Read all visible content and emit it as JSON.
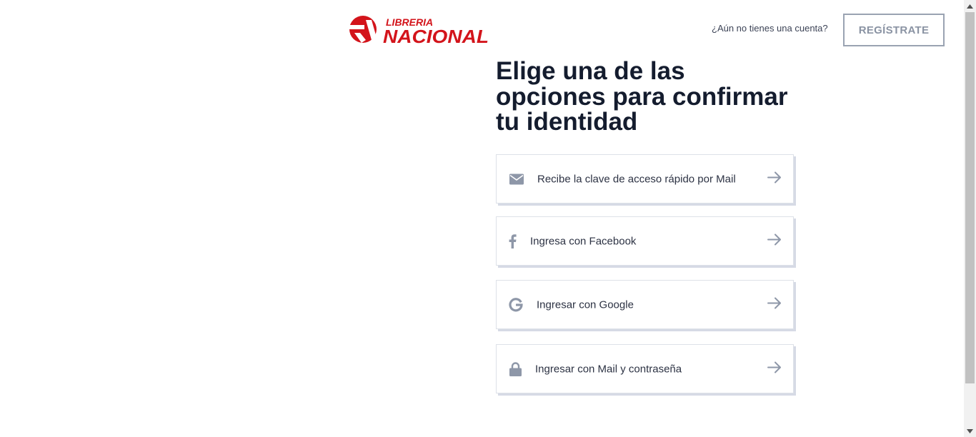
{
  "header": {
    "logo": {
      "top_text": "LIBRERIA",
      "main_text": "NACIONAL"
    },
    "account_question": "¿Aún no tienes una cuenta?",
    "register_label": "REGÍSTRATE"
  },
  "main": {
    "title": "Elige una de las opciones para confirmar tu identidad",
    "options": [
      {
        "label": "Recibe la clave de acceso rápido por Mail",
        "icon": "mail-icon"
      },
      {
        "label": "Ingresa con Facebook",
        "icon": "facebook-icon"
      },
      {
        "label": "Ingresar con Google",
        "icon": "google-icon"
      },
      {
        "label": "Ingresar con Mail y contraseña",
        "icon": "lock-icon"
      }
    ]
  },
  "colors": {
    "brand_red": "#d3141b",
    "icon_gray": "#8e97a8",
    "title": "#141c2e",
    "button_border": "#9aa3b2"
  }
}
